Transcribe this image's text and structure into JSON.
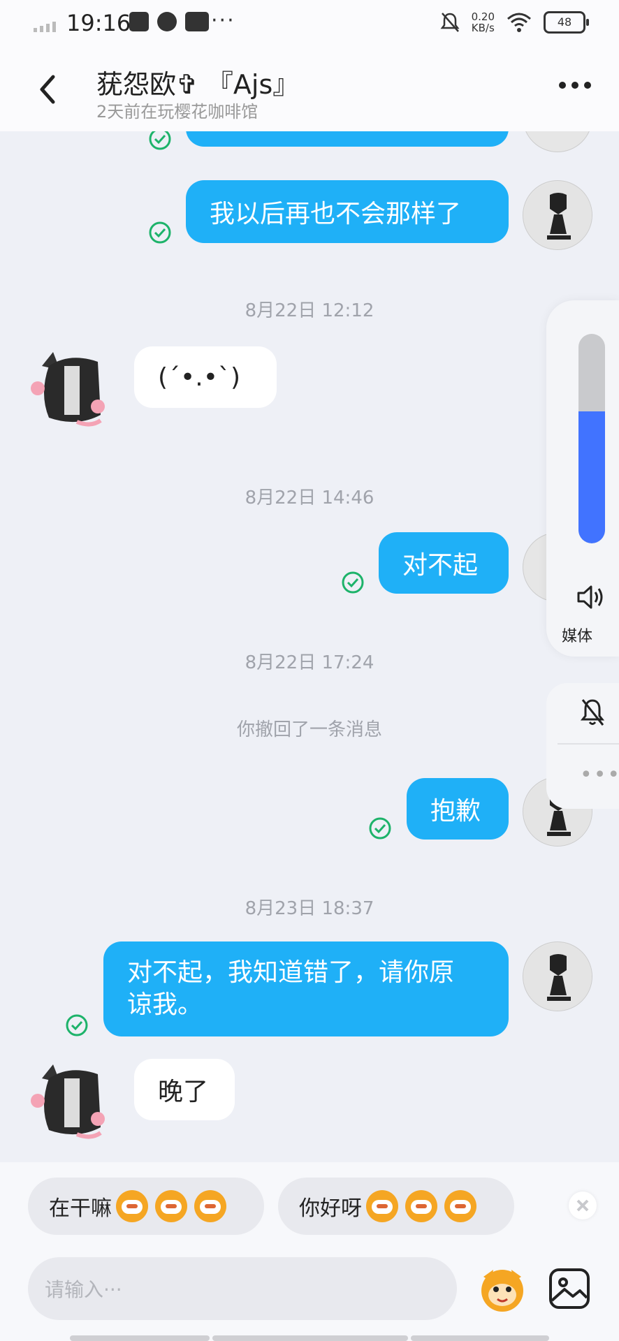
{
  "status_bar": {
    "time": "19:16",
    "net_speed_value": "0.20",
    "net_speed_unit": "KB/s",
    "battery": "48",
    "overflow": "···"
  },
  "header": {
    "title": "莸怨欧✞ 『Ajs』",
    "subtitle": "2天前在玩樱花咖啡馆"
  },
  "messages": {
    "m0": "我以后再也不会那样了",
    "ts1": "8月22日 12:12",
    "m1": "(´•.•`)",
    "ts2": "8月22日 14:46",
    "m2": "对不起",
    "ts3": "8月22日 17:24",
    "sys1": "你撤回了一条消息",
    "m3": "抱歉",
    "ts4": "8月23日 18:37",
    "m4_line1": "对不起，我知道错了，请你原",
    "m4_line2": "谅我。",
    "m5": "晚了"
  },
  "volume": {
    "label": "媒体",
    "level": 0.63
  },
  "quick_replies": [
    "在干嘛",
    "你好呀"
  ],
  "input": {
    "placeholder": "请输入···"
  },
  "colors": {
    "outgoing_bubble": "#1fb0f7",
    "read_check": "#1db36a",
    "volume_fill": "#4173ff"
  }
}
